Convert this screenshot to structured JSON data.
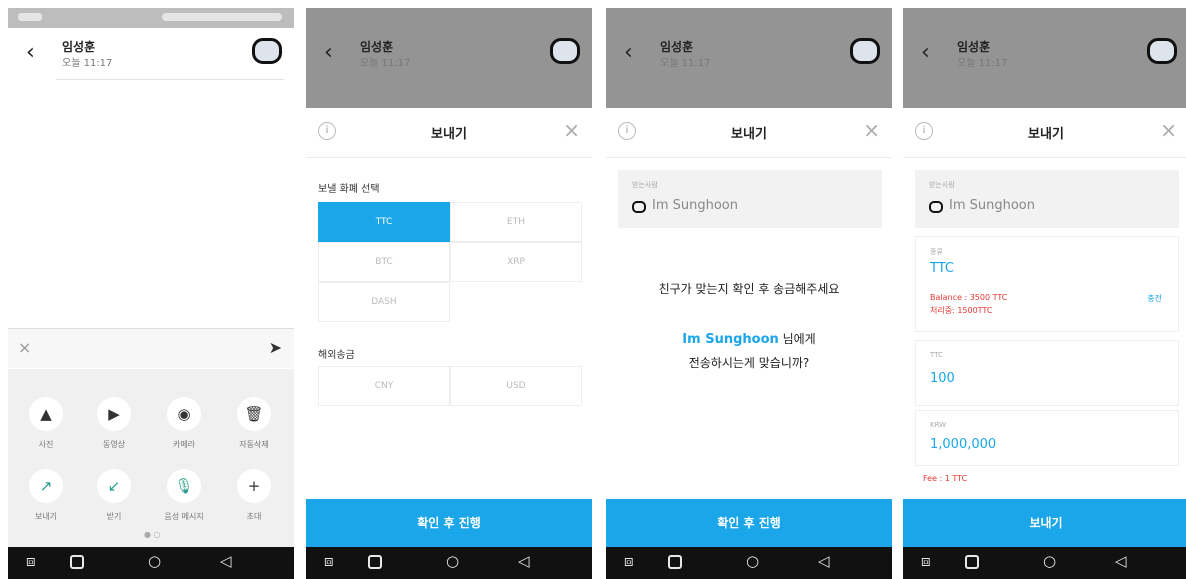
{
  "colors": {
    "accent": "#1aa6e8",
    "warning": "#e53935",
    "dim_overlay": "rgba(0,0,0,0.42)"
  },
  "chat_header": {
    "name": "임성훈",
    "time": "오늘 11:17",
    "back_icon": "chevron-left-icon",
    "avatar_icon": "rounded-square-avatar-icon"
  },
  "navbar": {
    "recent_icon": "recent-apps-icon",
    "home_icon": "square-home-icon",
    "circle_icon": "circle-home-icon",
    "back_icon": "triangle-back-icon"
  },
  "screen1": {
    "composer": {
      "close": "×",
      "placeholder": "",
      "send": "➤"
    },
    "tray": [
      {
        "label": "사진",
        "icon": "photo-icon",
        "glyph": "▲"
      },
      {
        "label": "동영상",
        "icon": "video-icon",
        "glyph": "▶"
      },
      {
        "label": "카메라",
        "icon": "camera-icon",
        "glyph": "◉"
      },
      {
        "label": "자동삭제",
        "icon": "trash-icon",
        "glyph": "🗑"
      },
      {
        "label": "보내기",
        "icon": "send-arrow-icon",
        "glyph": "↗"
      },
      {
        "label": "받기",
        "icon": "receive-arrow-icon",
        "glyph": "↙"
      },
      {
        "label": "음성 메시지",
        "icon": "microphone-icon",
        "glyph": "🎙"
      },
      {
        "label": "초대",
        "icon": "plus-icon",
        "glyph": "+"
      }
    ],
    "pager": "● ○"
  },
  "screen2": {
    "title": "보내기",
    "section1": "보낼 화폐 선택",
    "currencies": [
      "TTC",
      "ETH",
      "BTC",
      "XRP",
      "DASH"
    ],
    "selected": "TTC",
    "section2": "해외송금",
    "overseas": [
      "CNY",
      "USD"
    ],
    "button": "확인 후 진행"
  },
  "screen3": {
    "title": "보내기",
    "sender_caption": "받는사람",
    "recipient": "Im Sunghoon",
    "line1": "친구가 맞는지 확인 후 송금해주세요",
    "highlight": "Im Sunghoon",
    "line2_suffix": " 님에게",
    "line3": "전송하시는게 맞습니까?",
    "button": "확인 후 진행"
  },
  "screen4": {
    "title": "보내기",
    "sender_caption": "받는사람",
    "recipient": "Im Sunghoon",
    "coin_caption": "종류",
    "coin": "TTC",
    "balance": "Balance : 3500 TTC",
    "fee_note": "처리중: 1500TTC",
    "charge_link": "충전",
    "ttc_caption": "TTC",
    "ttc_amount": "100",
    "krw_caption": "KRW",
    "krw_amount": "1,000,000",
    "fee": "Fee : 1 TTC",
    "button": "보내기"
  }
}
